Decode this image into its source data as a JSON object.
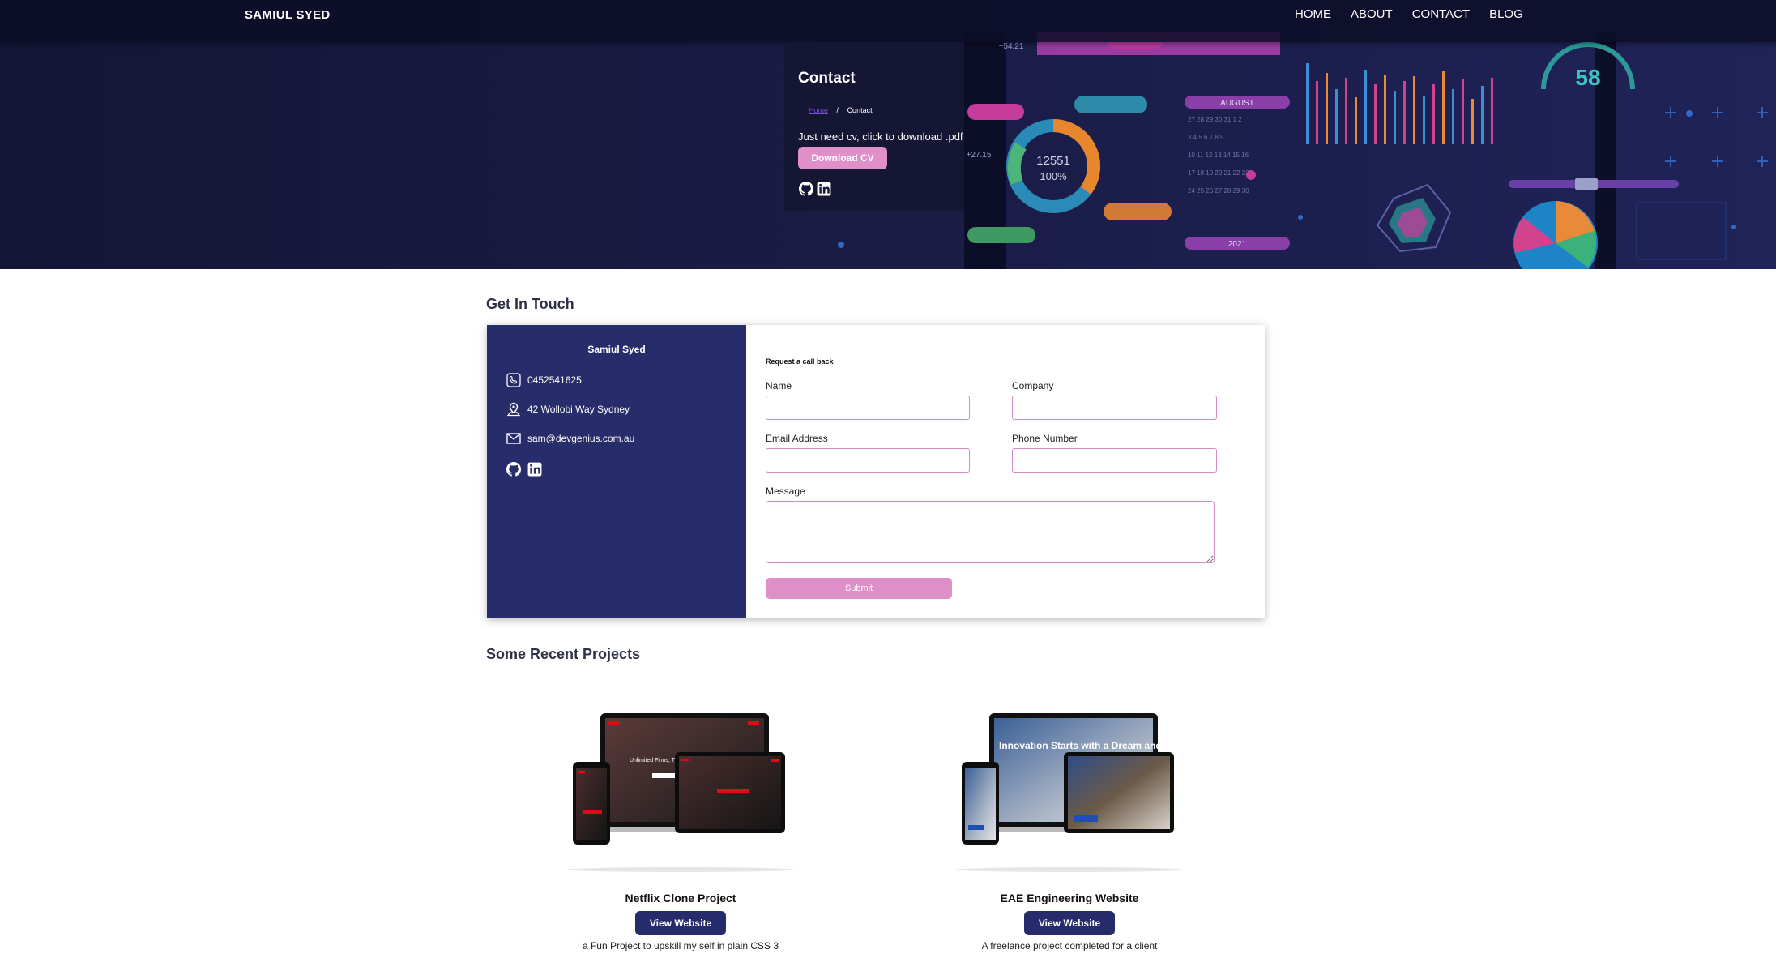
{
  "nav": {
    "brand": "SAMIUL SYED",
    "links": [
      "HOME",
      "ABOUT",
      "CONTACT",
      "BLOG"
    ]
  },
  "hero": {
    "title": "Contact",
    "breadcrumb": {
      "home": "Home",
      "separator": "/",
      "current": "Contact"
    },
    "cv_text": "Just need cv, click to download .pdf",
    "cv_button": "Download CV",
    "dashboard_labels": {
      "donut_value": "12551",
      "donut_percent": "100%",
      "month": "AUGUST",
      "year": "2021",
      "gauge": "58",
      "badge_top": "+54.21",
      "badge_left": "+27.15"
    }
  },
  "touch": {
    "section_title": "Get In Touch",
    "name": "Samiul Syed",
    "phone": "0452541625",
    "address": "42 Wollobi Way Sydney",
    "email": "sam@devgenius.com.au",
    "form": {
      "heading": "Request a call back",
      "name_label": "Name",
      "company_label": "Company",
      "email_label": "Email Address",
      "phone_label": "Phone Number",
      "message_label": "Message",
      "name_value": "",
      "company_value": "",
      "email_value": "",
      "phone_value": "",
      "message_value": "",
      "submit": "Submit"
    }
  },
  "projects": {
    "section_title": "Some Recent Projects",
    "items": [
      {
        "title": "Netflix Clone Project",
        "button": "View Website",
        "description": "a Fun Project to upskill my self in plain CSS 3",
        "screen_text": "Unlimited Films, TV Programmes and more."
      },
      {
        "title": "EAE Engineering Website",
        "button": "View Website",
        "description": "A freelance project completed for a client",
        "screen_text": "Innovation Starts with a Dream and a Plan"
      }
    ]
  },
  "colors": {
    "navy": "#272c6a",
    "pink": "#e08fc9",
    "hero_bg": "#15173a"
  }
}
